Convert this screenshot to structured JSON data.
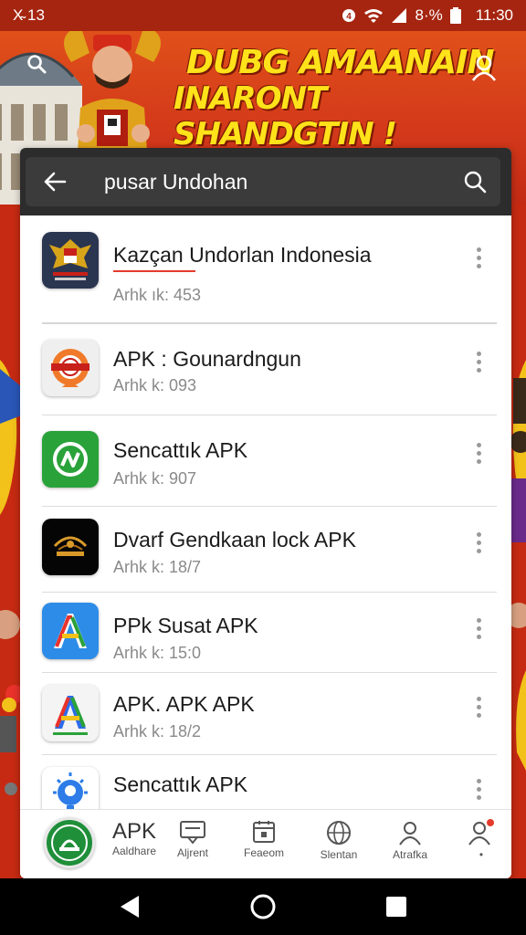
{
  "status_bar": {
    "left": "X̴ 13",
    "battery": "8⁰/₀",
    "battery_text": "8·%",
    "time": "11:30"
  },
  "banner": {
    "line1": "DUBG AMAANAIN",
    "line2": "INARONT SHANDGTIN !"
  },
  "search": {
    "query": "pusar Undohan"
  },
  "apps": [
    {
      "title": "Kazçan Undorlan Indonesia",
      "sub": "Arhk ık: 453",
      "icon": "garuda-emblem-icon"
    },
    {
      "title": "APK : Gounardngun",
      "sub": "Arhk k: 093",
      "icon": "seal-badge-icon"
    },
    {
      "title": "Sencattık APK",
      "sub": "Arhk k: 907",
      "icon": "green-n-logo-icon"
    },
    {
      "title": "Dvarf Gendkaan lock APK",
      "sub": "Arhk k: 18/7",
      "icon": "dark-crest-icon"
    },
    {
      "title": "PPk Susat APK",
      "sub": "Arhk k: 15:0",
      "icon": "colorful-a-logo-icon"
    },
    {
      "title": "APK. APK APK",
      "sub": "Arhk k: 18/2",
      "icon": "colorful-a-logo-small-icon"
    },
    {
      "title": "Sencattık APK",
      "sub": "",
      "icon": "blue-bulb-icon"
    }
  ],
  "bottom_nav": {
    "apk_label": "APK",
    "items": [
      {
        "label": "Aaldhare",
        "icon": "home-emblem-icon"
      },
      {
        "label": "Aljrent",
        "icon": "message-icon"
      },
      {
        "label": "Feaeom",
        "icon": "calendar-icon"
      },
      {
        "label": "Slentan",
        "icon": "globe-icon"
      },
      {
        "label": "Atrafka",
        "icon": "person-icon"
      },
      {
        "label": "•",
        "icon": "person-alert-icon"
      }
    ]
  },
  "colors": {
    "banner": "#d2381a",
    "banner_text": "#ffe21a",
    "search_bg": "#2c2c2c",
    "accent_red": "#e53b2c"
  }
}
